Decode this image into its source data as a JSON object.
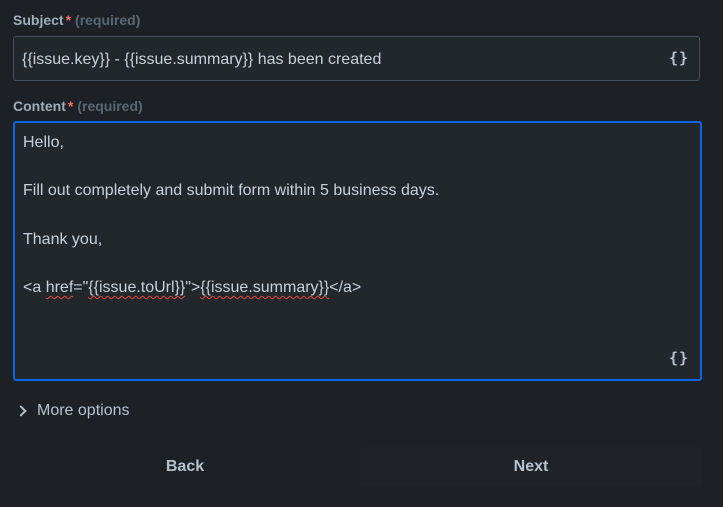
{
  "subject": {
    "label": "Subject",
    "required_mark": "*",
    "required_text": "(required)",
    "value": "{{issue.key}} - {{issue.summary}} has been created",
    "insert_icon": "{}"
  },
  "content": {
    "label": "Content",
    "required_mark": "*",
    "required_text": "(required)",
    "lines": {
      "greeting": "Hello,",
      "body": "Fill out completely and submit form within 5 business days.",
      "signoff": "Thank you,",
      "link_open": "<a ",
      "link_href": "href",
      "link_eq": "=\"",
      "link_url": "{{issue.toUrl}}",
      "link_mid": "\">",
      "link_text": "{{issue.summary}}",
      "link_close": "</a>"
    },
    "insert_icon": "{}"
  },
  "more_options": {
    "label": "More options",
    "icon": "chevron-right-icon"
  },
  "buttons": {
    "back": "Back",
    "next": "Next"
  },
  "colors": {
    "background": "#1d2125",
    "focus_border": "#0c66e4",
    "required": "#f87168",
    "spellcheck": "#e2483d"
  }
}
